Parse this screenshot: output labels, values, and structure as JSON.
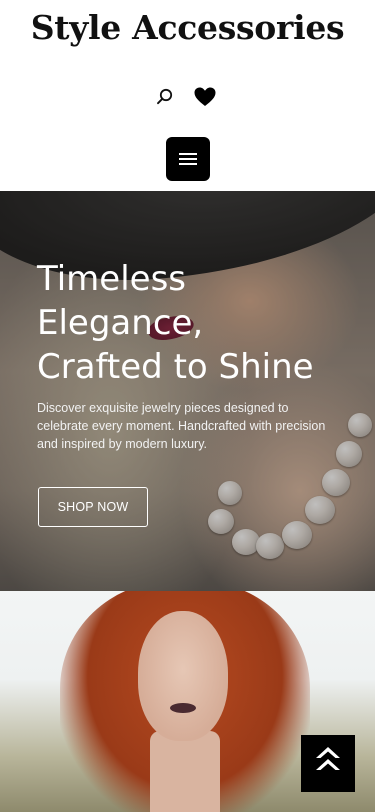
{
  "header": {
    "brand": "Style Accessories",
    "icons": {
      "search": "search-icon",
      "wishlist": "heart-icon",
      "menu": "menu-icon"
    }
  },
  "hero": {
    "title_lines": [
      "Timeless",
      "Elegance,",
      "Crafted to Shine"
    ],
    "description": "Discover exquisite jewelry pieces designed to celebrate every moment. Handcrafted with precision and inspired by modern luxury.",
    "cta_label": "SHOP NOW"
  },
  "scroll_top": {
    "icon": "double-chevron-up-icon"
  },
  "colors": {
    "header_bg": "#ffffff",
    "text_dark": "#111111",
    "button_dark": "#000000",
    "hero_text": "#ffffff"
  }
}
